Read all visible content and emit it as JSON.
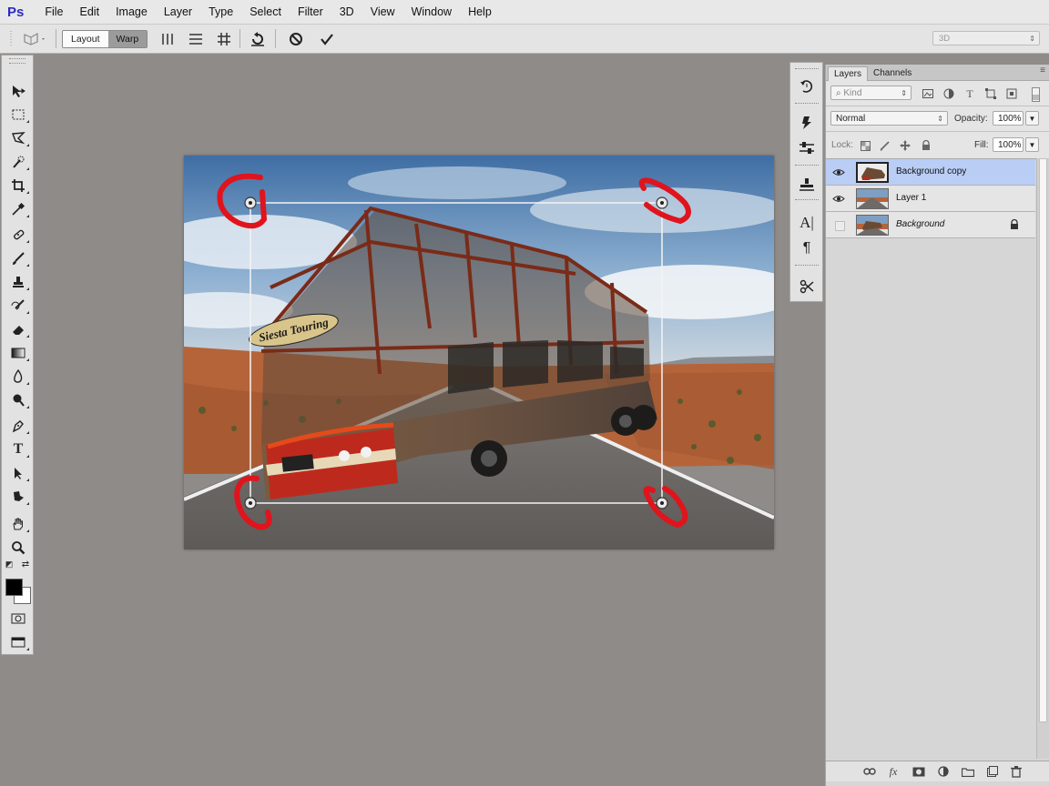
{
  "app": {
    "logo": "Ps"
  },
  "menu": [
    "File",
    "Edit",
    "Image",
    "Layer",
    "Type",
    "Select",
    "Filter",
    "3D",
    "View",
    "Window",
    "Help"
  ],
  "options_bar": {
    "tool_icon": "puppet-warp-icon",
    "segments": [
      "Layout",
      "Warp"
    ],
    "active_segment": "Layout",
    "grid_icons": [
      "split-vertical-icon",
      "split-horizontal-icon",
      "split-cross-icon"
    ],
    "actions": [
      "rotate-icon",
      "cancel-icon",
      "commit-icon"
    ],
    "workspace_select": "3D"
  },
  "tools": [
    "move-icon",
    "marquee-icon",
    "lasso-icon",
    "quick-select-icon",
    "crop-icon",
    "eyedropper-icon",
    "healing-icon",
    "brush-icon",
    "stamp-icon",
    "history-brush-icon",
    "eraser-icon",
    "gradient-icon",
    "blur-icon",
    "dodge-icon",
    "pen-icon",
    "type-icon",
    "path-select-icon",
    "shape-icon",
    "hand-icon",
    "zoom-icon"
  ],
  "colors": {
    "foreground": "#000000",
    "background": "#ffffff",
    "selection": "#b9cdf5",
    "markup": "#e0141c"
  },
  "dock_icons": [
    "history-icon",
    "actions-icon",
    "adjustments-icon",
    "properties-icon",
    "character-icon",
    "paragraph-icon",
    "tool-presets-icon"
  ],
  "layers_panel": {
    "tabs": [
      "Layers",
      "Channels"
    ],
    "active_tab": "Layers",
    "filter": {
      "label": "Kind"
    },
    "blend_mode": "Normal",
    "opacity_label": "Opacity:",
    "opacity_value": "100%",
    "lock_label": "Lock:",
    "fill_label": "Fill:",
    "fill_value": "100%",
    "layers": [
      {
        "name": "Background copy",
        "visible": true,
        "selected": true,
        "locked": false
      },
      {
        "name": "Layer 1",
        "visible": true,
        "selected": false,
        "locked": false
      },
      {
        "name": "Background",
        "visible": false,
        "selected": false,
        "locked": true
      }
    ],
    "footer_icons": [
      "link-icon",
      "fx-icon",
      "mask-icon",
      "adjustment-icon",
      "group-icon",
      "new-layer-icon",
      "trash-icon"
    ]
  },
  "canvas": {
    "bus_sign": "Siesta Touring"
  }
}
